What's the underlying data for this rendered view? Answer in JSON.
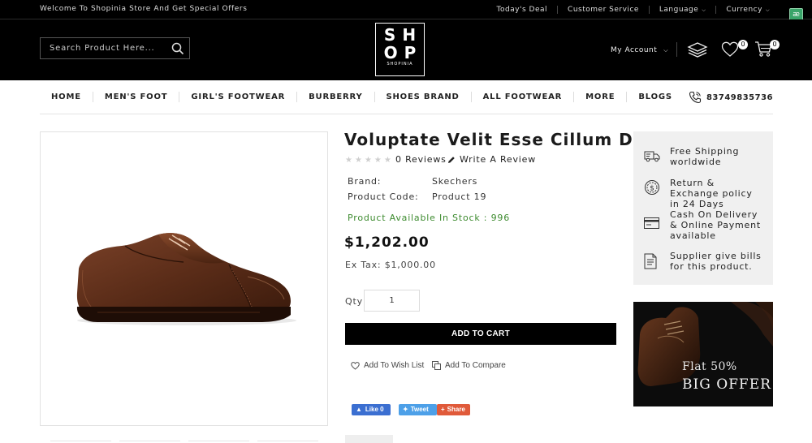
{
  "topbar": {
    "welcome": "Welcome To Shopinia Store And Get Special Offers",
    "links": [
      "Today's Deal",
      "Customer Service",
      "Language",
      "Currency"
    ]
  },
  "header": {
    "search_placeholder": "Search Product Here...",
    "logo_line1": "SH",
    "logo_line2": "OP",
    "logo_sub": "SHOPINIA",
    "account_label": "My Account",
    "wishlist_count": "0",
    "cart_count": "0"
  },
  "nav": {
    "items": [
      "HOME",
      "MEN'S FOOT",
      "GIRL'S FOOTWEAR",
      "BURBERRY",
      "SHOES BRAND",
      "ALL FOOTWEAR",
      "MORE",
      "BLOGS"
    ],
    "phone": "83749835736"
  },
  "product": {
    "title": "Voluptate Velit Esse Cillum Dolore",
    "rating": 0,
    "reviews_label": "0 Reviews",
    "write_review_label": "Write A Review",
    "brand_label": "Brand:",
    "brand_value": "Skechers",
    "code_label": "Product Code:",
    "code_value": "Product 19",
    "stock_label": "Product Available In Stock :",
    "stock_value": "996",
    "price": "$1,202.00",
    "ex_tax": "Ex Tax: $1,000.00",
    "qty_label": "Qty",
    "qty_value": "1",
    "add_to_cart": "ADD TO CART",
    "wishlist_label": "Add To Wish List",
    "compare_label": "Add To Compare",
    "like_label": "Like 0",
    "tweet_label": "Tweet",
    "share_label": "Share"
  },
  "info": [
    {
      "icon": "truck-icon",
      "text": "Free Shipping worldwide"
    },
    {
      "icon": "money-return-icon",
      "text": "Return & Exchange policy in 24 Days"
    },
    {
      "icon": "credit-card-icon",
      "text": "Cash On Delivery & Online Payment available"
    },
    {
      "icon": "document-icon",
      "text": "Supplier give bills for this product."
    }
  ],
  "banner": {
    "line1": "Flat 50%",
    "line2": "BIG OFFER"
  },
  "colors": {
    "header_bg": "#000000",
    "stock_green": "#3d8b2f",
    "facebook_blue": "#3b6fd1",
    "twitter_blue": "#4da0e8",
    "share_red": "#e05a3a",
    "panel_bg": "#f0f0f0"
  }
}
